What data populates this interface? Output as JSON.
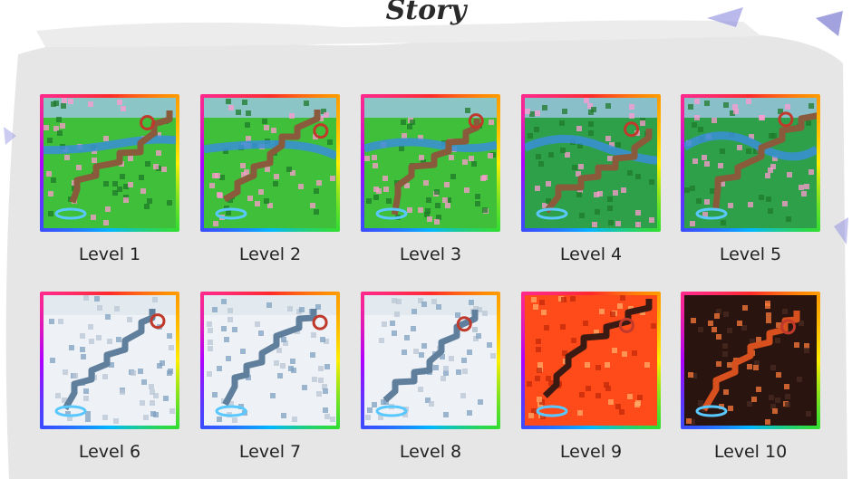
{
  "page": {
    "title": "Story"
  },
  "levels": [
    {
      "label": "Level 1",
      "theme": "grass"
    },
    {
      "label": "Level 2",
      "theme": "grass"
    },
    {
      "label": "Level 3",
      "theme": "grass"
    },
    {
      "label": "Level 4",
      "theme": "forest"
    },
    {
      "label": "Level 5",
      "theme": "forest"
    },
    {
      "label": "Level 6",
      "theme": "snow"
    },
    {
      "label": "Level 7",
      "theme": "snow"
    },
    {
      "label": "Level 8",
      "theme": "snow"
    },
    {
      "label": "Level 9",
      "theme": "lava"
    },
    {
      "label": "Level 10",
      "theme": "lava-dark"
    }
  ],
  "colors": {
    "frame_gradient": [
      "#ff2a2a",
      "#ff9a00",
      "#ffee00",
      "#33dd33",
      "#00b7ff",
      "#3b4cff",
      "#b000ff"
    ],
    "grass": "#3fbf3a",
    "path": "#8a5a3c",
    "water": "#3a8ed8",
    "snow": "#eef2f6",
    "snow_path": "#5f7f9c",
    "lava": "#ff4a1a",
    "lava_dark": "#2a1410"
  }
}
